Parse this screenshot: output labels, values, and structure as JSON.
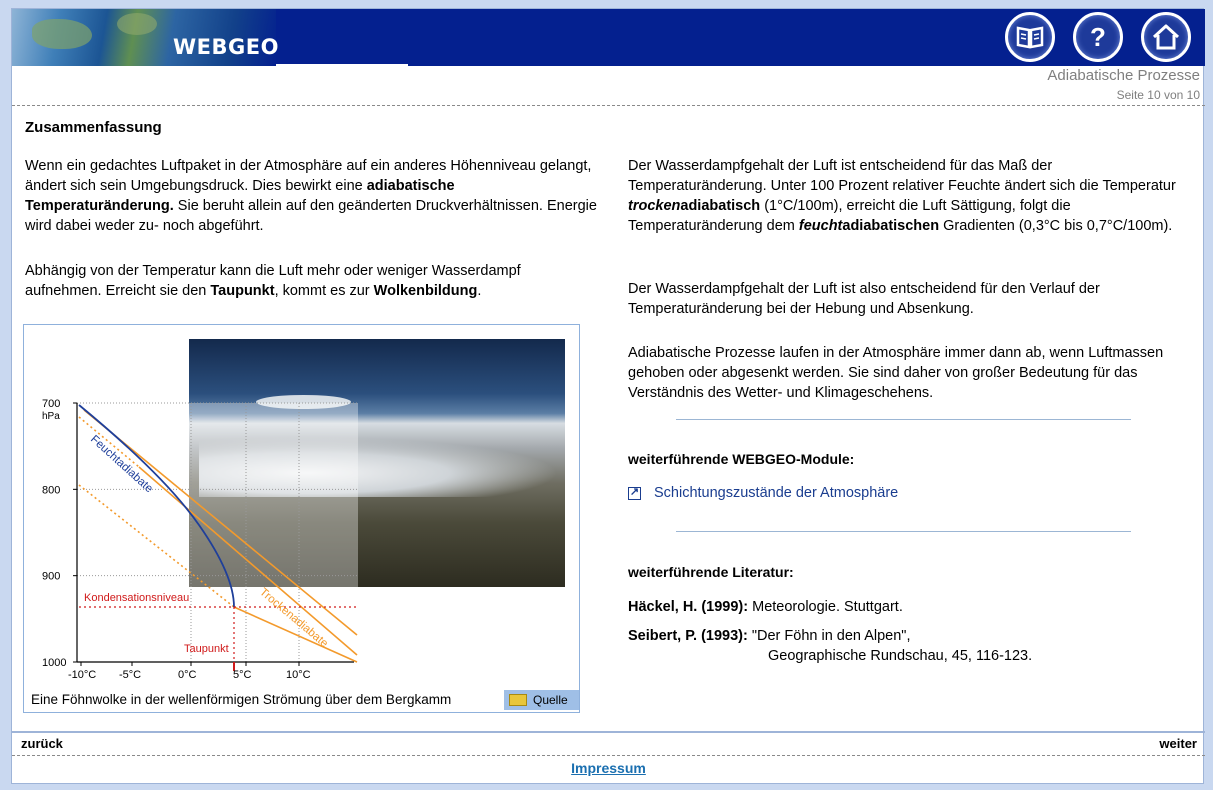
{
  "header": {
    "logo_text": "WEBGEO",
    "buttons": {
      "book": "book-icon",
      "help": "?",
      "home": "home-icon"
    }
  },
  "page": {
    "topic": "Adiabatische Prozesse",
    "page_info": "Seite 10 von 10",
    "heading": "Zusammenfassung"
  },
  "left": {
    "p1": [
      {
        "t": "Wenn ein gedachtes Luftpaket in der Atmosphäre auf ein anderes Höhenniveau gelangt, ändert sich sein Umgebungsdruck. Dies bewirkt eine ",
        "b": false
      },
      {
        "t": "adiabatische Temperaturänderung.",
        "b": true
      },
      {
        "t": " Sie beruht allein auf den geänderten Druckverhältnissen. Energie wird dabei weder zu- noch abgeführt.",
        "b": false
      }
    ],
    "p2": [
      {
        "t": "Abhängig von der Temperatur kann die Luft mehr oder weniger Wasserdampf aufnehmen. Erreicht sie den ",
        "b": false
      },
      {
        "t": "Taupunkt",
        "b": true
      },
      {
        "t": ", kommt es zur ",
        "b": false
      },
      {
        "t": "Wolkenbildung",
        "b": true
      },
      {
        "t": ".",
        "b": false
      }
    ]
  },
  "right": {
    "p3": [
      {
        "t": "Der Wasserdampfgehalt der Luft ist entscheidend für das Maß der Temperaturänderung. Unter 100 Prozent relativer Feuchte ändert sich die Temperatur ",
        "b": false
      },
      {
        "t": "trocken",
        "b": true,
        "i": true
      },
      {
        "t": "adiabatisch",
        "b": true
      },
      {
        "t": " (1°C/100m), erreicht die Luft Sättigung, folgt die Temperaturänderung dem ",
        "b": false
      },
      {
        "t": "feucht",
        "b": true,
        "i": true
      },
      {
        "t": "adiabatischen",
        "b": true
      },
      {
        "t": " Gradienten (0,3°C bis 0,7°C/100m).",
        "b": false
      }
    ],
    "p4": "Der Wasserdampfgehalt der Luft ist also entscheidend für den Verlauf der Temperaturänderung bei der Hebung und Absenkung.",
    "p5": "Adiabatische Prozesse laufen in der Atmosphäre immer dann ab, wenn Luftmassen gehoben oder abgesenkt werden. Sie sind daher von großer Bedeutung für das Verständnis des Wetter- und Klimageschehens.",
    "modules_heading": "weiterführende WEBGEO-Module:",
    "module_link": "Schichtungszustände der Atmosphäre",
    "literature_heading": "weiterführende Literatur:",
    "literature": [
      {
        "author": "Häckel, H. (1999):",
        "text": " Meteorologie. Stuttgart.",
        "line2": ""
      },
      {
        "author": "Seibert, P. (1993):",
        "text": " \"Der Föhn in den Alpen\",",
        "line2": "Geographische Rundschau, 45, 116-123."
      }
    ]
  },
  "figure": {
    "caption": "Eine Föhnwolke in der wellenförmigen Strömung über dem Bergkamm",
    "source_label": "Quelle",
    "y_ticks": [
      "700",
      "800",
      "900",
      "1000"
    ],
    "y_unit": "hPa",
    "x_ticks": [
      "-10°C",
      "-5°C",
      "0°C",
      "5°C",
      "10°C"
    ],
    "labels": {
      "feucht": "Feuchtadiabate",
      "trocken": "Trockenadiabate",
      "kondensation": "Kondensationsniveau",
      "taupunkt": "Taupunkt"
    },
    "colors": {
      "feucht": "#1f3f9a",
      "trocken": "#f39a2c",
      "kond": "#d01a1a"
    }
  },
  "footer": {
    "back": "zurück",
    "next": "weiter",
    "impressum": "Impressum"
  }
}
